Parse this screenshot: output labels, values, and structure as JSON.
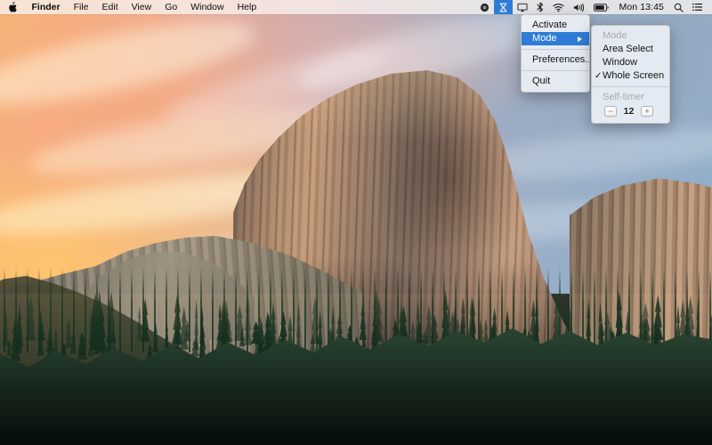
{
  "menubar": {
    "apple_icon": "apple-logo-icon",
    "app_menus": [
      {
        "label": "Finder",
        "bold": true
      },
      {
        "label": "File",
        "bold": false
      },
      {
        "label": "Edit",
        "bold": false
      },
      {
        "label": "View",
        "bold": false
      },
      {
        "label": "Go",
        "bold": false
      },
      {
        "label": "Window",
        "bold": false
      },
      {
        "label": "Help",
        "bold": false
      }
    ],
    "status_items": [
      {
        "name": "dropbox-icon",
        "active": false
      },
      {
        "name": "screenshot-app-icon",
        "active": true
      },
      {
        "name": "airplay-display-icon",
        "active": false
      },
      {
        "name": "bluetooth-icon",
        "active": false
      },
      {
        "name": "wifi-icon",
        "active": false
      },
      {
        "name": "volume-icon",
        "active": false
      },
      {
        "name": "battery-icon",
        "active": false
      }
    ],
    "clock": "Mon 13:45",
    "spotlight_icon": "search-icon",
    "notification_center_icon": "list-lines-icon"
  },
  "main_menu": {
    "items": [
      {
        "label": "Activate",
        "type": "item",
        "highlight": false,
        "submenu": false
      },
      {
        "label": "Mode",
        "type": "item",
        "highlight": true,
        "submenu": true
      },
      {
        "label": "",
        "type": "separator"
      },
      {
        "label": "Preferences...",
        "type": "item",
        "highlight": false,
        "submenu": false
      },
      {
        "label": "",
        "type": "separator"
      },
      {
        "label": "Quit",
        "type": "item",
        "highlight": false,
        "submenu": false
      }
    ]
  },
  "sub_menu": {
    "header": "Mode",
    "items": [
      {
        "label": "Area Select",
        "checked": false
      },
      {
        "label": "Window",
        "checked": false
      },
      {
        "label": "Whole Screen",
        "checked": true
      }
    ],
    "check_glyph": "✓",
    "self_timer": {
      "label": "Self-timer",
      "decrement_label": "−",
      "value": "12",
      "increment_label": "+"
    }
  },
  "colors": {
    "accent_highlight": "#2f7cd6",
    "menubar_background": "#f6f1ee",
    "menu_text": "#131313",
    "disabled_text": "#a9a9a9"
  }
}
